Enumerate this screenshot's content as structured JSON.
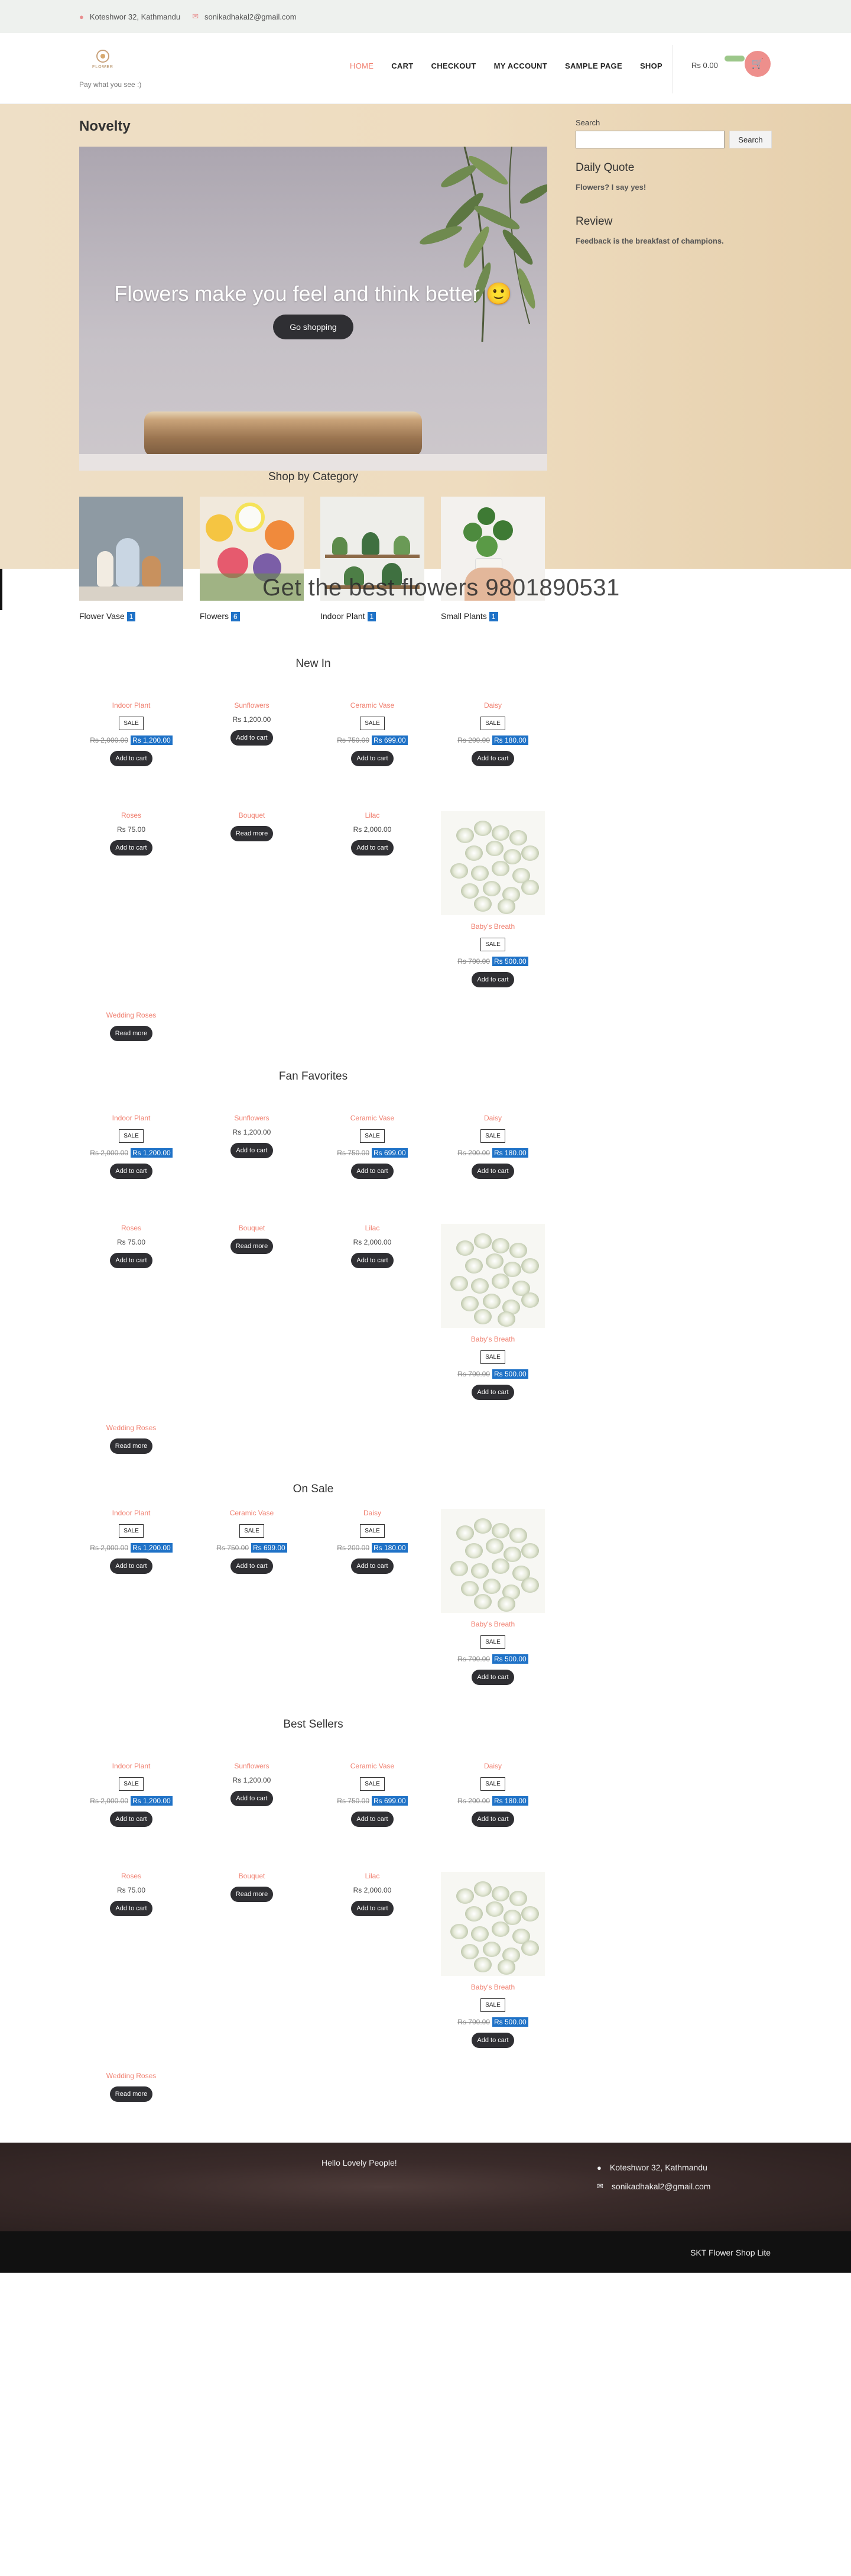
{
  "topbar": {
    "address": "Koteshwor 32, Kathmandu",
    "email": "sonikadhakal2@gmail.com",
    "address_icon": "map-pin-icon",
    "email_icon": "envelope-icon"
  },
  "header": {
    "logo_text": "FLOWER",
    "tagline": "Pay what you see :)",
    "nav": [
      "HOME",
      "CART",
      "CHECKOUT",
      "MY ACCOUNT",
      "SAMPLE PAGE",
      "SHOP"
    ],
    "active_nav": "HOME",
    "cart_total": "Rs 0.00",
    "cart_icon": "shopping-cart-icon"
  },
  "colors": {
    "accent": "#f07e6e",
    "sale_blue": "#1f72c7",
    "button_dark": "#2f2f33",
    "hero_bg": "#eedfc6",
    "cart_pink": "#ee8f8c"
  },
  "page_title": "Novelty",
  "slider": {
    "caption": "Flowers make you feel and think better 🙂",
    "button": "Go shopping"
  },
  "categories": {
    "heading": "Shop by Category",
    "items": [
      {
        "label": "Flower Vase",
        "count": "1"
      },
      {
        "label": "Flowers",
        "count": "6"
      },
      {
        "label": "Indoor Plant",
        "count": "1"
      },
      {
        "label": "Small Plants",
        "count": "1"
      }
    ]
  },
  "sidebar": {
    "search_label": "Search",
    "search_button": "Search",
    "quote_title": "Daily Quote",
    "quote_text": "Flowers? I say yes!",
    "review_title": "Review",
    "review_text": "Feedback is the breakfast of champions."
  },
  "band_text": "Get the best flowers 9801890531",
  "sections": {
    "new_in": "New In",
    "fan_favorites": "Fan Favorites",
    "on_sale": "On Sale",
    "best_sellers": "Best Sellers"
  },
  "products": {
    "indoor_plant": {
      "name": "Indoor Plant",
      "sale": "SALE",
      "old_price": "Rs 2,000.00",
      "price": "Rs 1,200.00",
      "button": "Add to cart"
    },
    "sunflowers": {
      "name": "Sunflowers",
      "price": "Rs 1,200.00",
      "button": "Add to cart"
    },
    "ceramic_vase": {
      "name": "Ceramic Vase",
      "sale": "SALE",
      "old_price": "Rs 750.00",
      "price": "Rs 699.00",
      "button": "Add to cart"
    },
    "daisy": {
      "name": "Daisy",
      "sale": "SALE",
      "old_price": "Rs 200.00",
      "price": "Rs 180.00",
      "button": "Add to cart"
    },
    "roses": {
      "name": "Roses",
      "price": "Rs 75.00",
      "button": "Add to cart"
    },
    "bouquet": {
      "name": "Bouquet",
      "button": "Read more"
    },
    "lilac": {
      "name": "Lilac",
      "price": "Rs 2,000.00",
      "button": "Add to cart"
    },
    "babys_breath": {
      "name": "Baby's Breath",
      "sale": "SALE",
      "old_price": "Rs 700.00",
      "price": "Rs 500.00",
      "button": "Add to cart"
    },
    "wedding_roses": {
      "name": "Wedding Roses",
      "button": "Read more"
    }
  },
  "footer": {
    "hello": "Hello Lovely People!",
    "address": "Koteshwor 32, Kathmandu",
    "email": "sonikadhakal2@gmail.com",
    "copyright": "SKT Flower Shop Lite"
  }
}
